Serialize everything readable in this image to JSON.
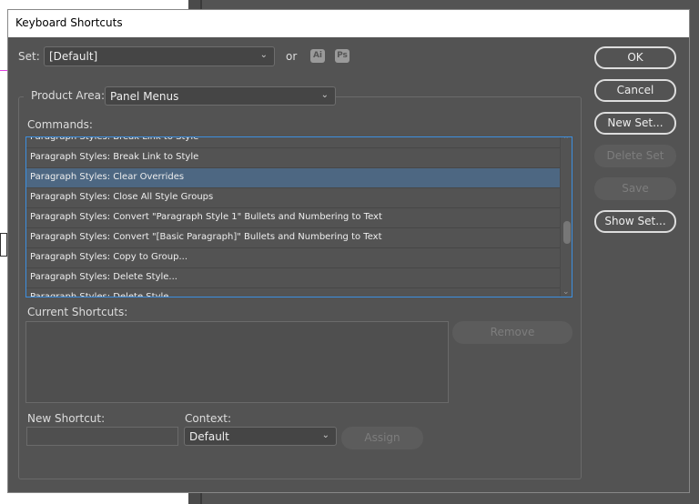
{
  "dialog": {
    "title": "Keyboard Shortcuts"
  },
  "set": {
    "label": "Set:",
    "value": "[Default]",
    "or": "or",
    "ai_badge": "Ai",
    "ps_badge": "Ps"
  },
  "product_area": {
    "label": "Product Area:",
    "value": "Panel Menus"
  },
  "commands": {
    "label": "Commands:",
    "items": [
      "Paragraph Styles: Break Link to Style",
      "Paragraph Styles: Break Link to Style",
      "Paragraph Styles: Clear Overrides",
      "Paragraph Styles: Close All Style Groups",
      "Paragraph Styles: Convert \"Paragraph Style 1\" Bullets and Numbering to Text",
      "Paragraph Styles: Convert \"[Basic Paragraph]\" Bullets and Numbering to Text",
      "Paragraph Styles: Copy to Group...",
      "Paragraph Styles: Delete Style...",
      "Paragraph Styles: Delete Style..."
    ],
    "selected_index": 2,
    "scroll_position_percent": 62
  },
  "current_shortcuts": {
    "label": "Current Shortcuts:",
    "remove": "Remove"
  },
  "new_shortcut": {
    "label": "New Shortcut:",
    "value": ""
  },
  "context": {
    "label": "Context:",
    "value": "Default"
  },
  "assign": "Assign",
  "buttons": {
    "ok": "OK",
    "cancel": "Cancel",
    "new_set": "New Set...",
    "delete_set": "Delete Set",
    "save": "Save",
    "show_set": "Show Set..."
  }
}
